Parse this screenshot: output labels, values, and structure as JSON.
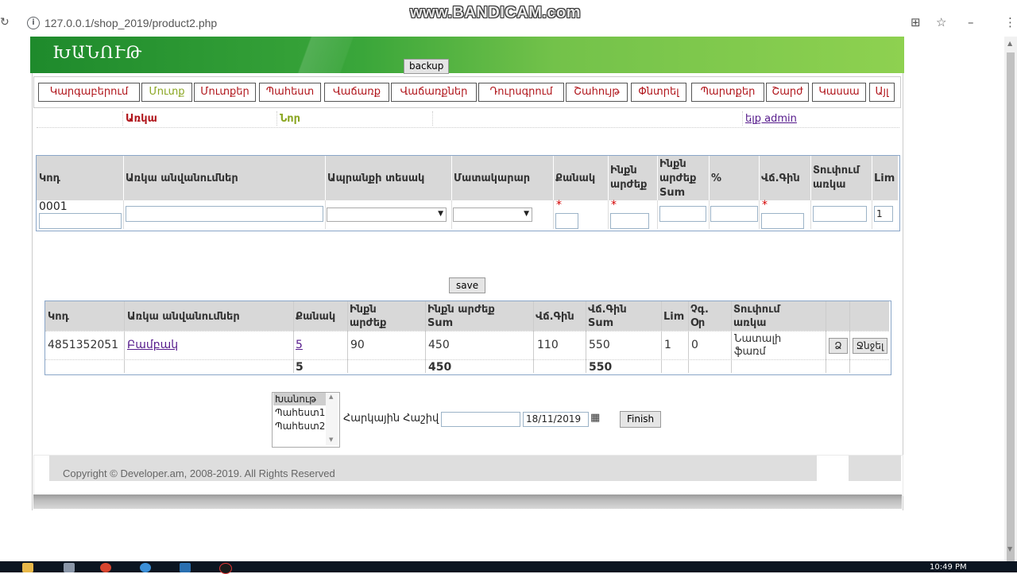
{
  "browser": {
    "url": "127.0.0.1/shop_2019/product2.php",
    "watermark": "www.BANDICAM.com"
  },
  "header": {
    "title": "ԽԱՆՈՒԹ",
    "backup_label": "backup"
  },
  "nav": {
    "items": [
      "Կարգաբերում",
      "Մուտք",
      "Մուտքեր",
      "Պահեստ",
      "Վաճառք",
      "Վաճառքներ",
      "Դուրսգրում",
      "Շահույթ",
      "Փնտրել",
      "Պարտքեր",
      "Շարժ",
      "Կասսա",
      "Այլ"
    ],
    "active": "Մուտք"
  },
  "subnav": {
    "item1": "Առկա",
    "item2": "Նոր",
    "logout": "ելք admin"
  },
  "form": {
    "headers": [
      "Կոդ",
      "Առկա անվանումներ",
      "Ապրանքի տեսակ",
      "Մատակարար",
      "Քանակ",
      "Ինքն արժեք",
      "Ինքն արժեք Sum",
      "%",
      "Վճ.Գին",
      "Տուփում առկա",
      "Lim"
    ],
    "code_value": "0001",
    "lim_value": "1",
    "required_mark": "*"
  },
  "save_label": "save",
  "results": {
    "headers": [
      "Կոդ",
      "Առկա անվանումներ",
      "Քանակ",
      "Ինքն արժեք",
      "Ինքն արժեք Sum",
      "Վճ.Գին",
      "Վճ.Գին Sum",
      "Lim",
      "Չգ. Օր",
      "Տուփում առկա"
    ],
    "row": {
      "code": "4851352051",
      "name": "Բամբակ",
      "qty": "5",
      "cost": "90",
      "cost_sum": "450",
      "price": "110",
      "price_sum": "550",
      "lim": "1",
      "days": "0",
      "box": "Նատալի ֆառմ",
      "btn_edit": "Ձ",
      "btn_delete": "Ջնջել"
    },
    "totals": {
      "qty": "5",
      "cost_sum": "450",
      "price_sum": "550"
    }
  },
  "bottom": {
    "list_options": [
      "Խանութ",
      "Պահեստ1",
      "Պահեստ2"
    ],
    "list_selected": "Խանութ",
    "account_label": "Հարկային Հաշիվ",
    "date_value": "18/11/2019",
    "finish_label": "Finish"
  },
  "footer": {
    "copyright": "Copyright © Developer.am, 2008-2019. All Rights Reserved"
  },
  "taskbar": {
    "clock": "10:49 PM"
  }
}
